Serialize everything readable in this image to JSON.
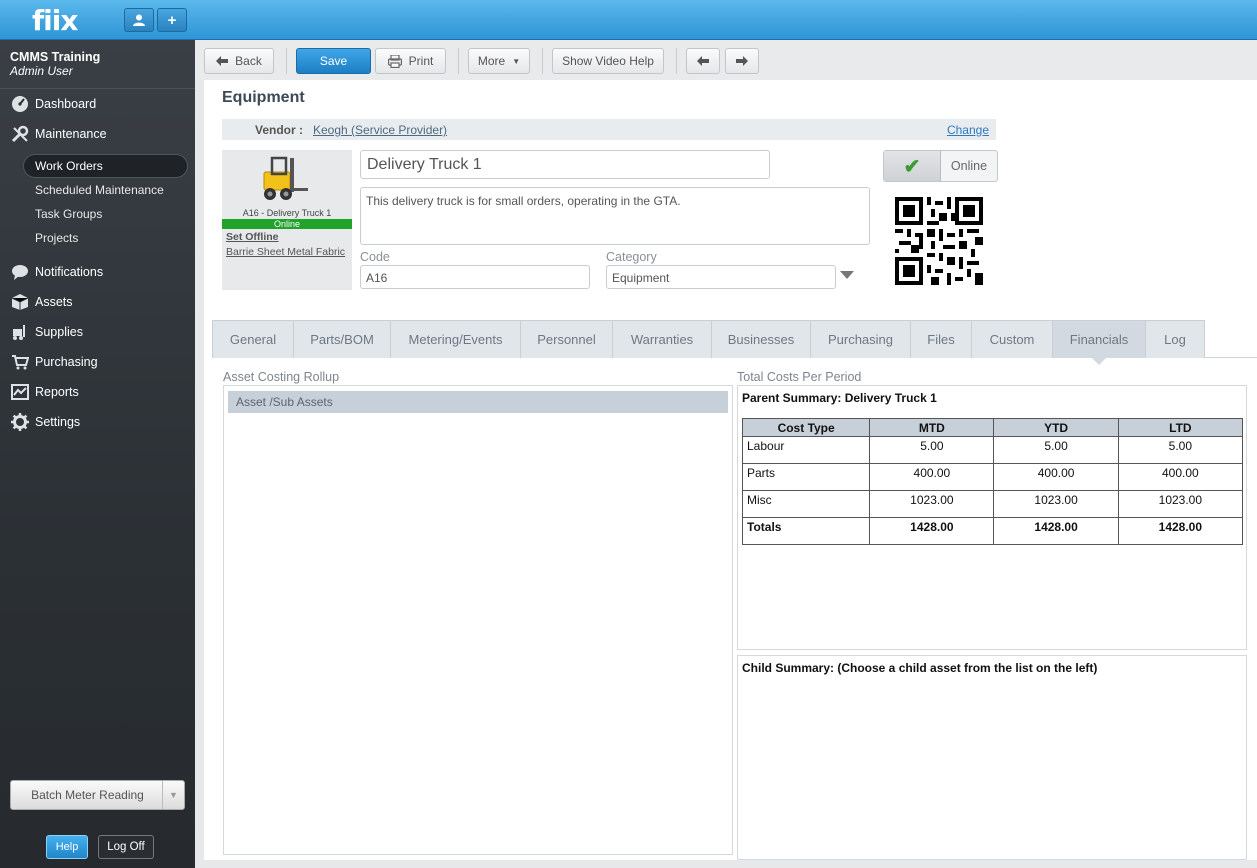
{
  "app": {
    "logo": "fiix"
  },
  "topbar": {
    "user_icon": "user-icon",
    "add_label": "+"
  },
  "sidebar": {
    "org_name": "CMMS Training",
    "user_name": "Admin User",
    "nav": [
      {
        "label": "Dashboard",
        "icon": "dashboard-icon"
      },
      {
        "label": "Maintenance",
        "icon": "wrench-icon"
      },
      {
        "label": "Notifications",
        "icon": "chat-bubble-icon"
      },
      {
        "label": "Assets",
        "icon": "box-icon"
      },
      {
        "label": "Supplies",
        "icon": "forklift-icon"
      },
      {
        "label": "Purchasing",
        "icon": "cart-icon"
      },
      {
        "label": "Reports",
        "icon": "chart-icon"
      },
      {
        "label": "Settings",
        "icon": "gear-icon"
      }
    ],
    "maintenance_sub": [
      "Work Orders",
      "Scheduled Maintenance",
      "Task Groups",
      "Projects"
    ],
    "batch_meter_label": "Batch Meter Reading",
    "help_label": "Help",
    "logoff_label": "Log Off"
  },
  "toolbar": {
    "back_label": "Back",
    "save_label": "Save",
    "print_label": "Print",
    "more_label": "More",
    "video_help_label": "Show Video Help"
  },
  "page": {
    "title": "Equipment",
    "vendor_label": "Vendor :",
    "vendor_value": "Keogh (Service Provider)",
    "change_label": "Change",
    "asset_caption": "A16 - Delivery Truck 1",
    "asset_status": "Online",
    "set_offline_label": "Set Offline",
    "location": "Barrie Sheet Metal Fabric",
    "name_value": "Delivery Truck 1",
    "description_value": "This delivery truck is for small orders, operating in the GTA.",
    "code_label": "Code",
    "code_value": "A16",
    "category_label": "Category",
    "category_value": "Equipment",
    "online_toggle_label": "Online"
  },
  "tabs": [
    "General",
    "Parts/BOM",
    "Metering/Events",
    "Personnel",
    "Warranties",
    "Businesses",
    "Purchasing",
    "Files",
    "Custom",
    "Financials",
    "Log"
  ],
  "active_tab": "Financials",
  "financials": {
    "rollup_title": "Asset Costing Rollup",
    "rollup_header": "Asset /Sub Assets",
    "period_title": "Total Costs Per Period",
    "parent_summary": "Parent Summary: Delivery Truck 1",
    "columns": [
      "Cost Type",
      "MTD",
      "YTD",
      "LTD"
    ],
    "rows": [
      [
        "Labour",
        "5.00",
        "5.00",
        "5.00"
      ],
      [
        "Parts",
        "400.00",
        "400.00",
        "400.00"
      ],
      [
        "Misc",
        "1023.00",
        "1023.00",
        "1023.00"
      ],
      [
        "Totals",
        "1428.00",
        "1428.00",
        "1428.00"
      ]
    ],
    "child_summary": "Child Summary: (Choose a child asset from the list on the left)"
  },
  "colors": {
    "accent": "#2e95d6",
    "status_online": "#21a22b",
    "sidebar_bg": "#2b3035"
  }
}
